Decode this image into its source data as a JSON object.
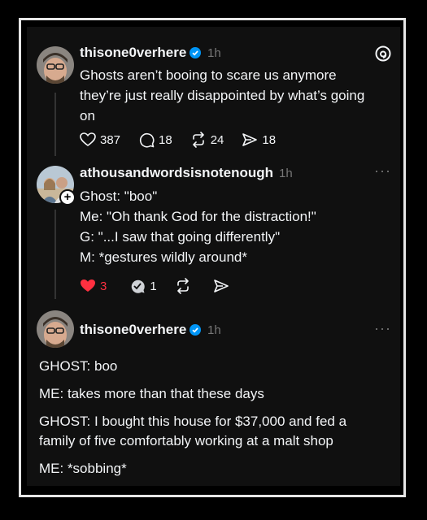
{
  "post1": {
    "username": "thisone0verhere",
    "time": "1h",
    "lines": [
      "Ghosts aren’t booing to scare us anymore",
      "they’re just really disappointed by what’s going",
      "on"
    ],
    "likes": "387",
    "replies": "18",
    "reposts": "24",
    "shares": "18"
  },
  "post2": {
    "username": "athousandwordsisnotenough",
    "time": "1h",
    "lines": [
      "Ghost: \"boo\"",
      "Me: \"Oh thank God for the distraction!\"",
      "G: \"...I saw that going differently\"",
      "M: *gestures wildly around*"
    ],
    "likes": "3",
    "replies": "1",
    "more": "···"
  },
  "post3": {
    "username": "thisone0verhere",
    "time": "1h",
    "more": "···",
    "paragraphs": [
      [
        "GHOST: boo"
      ],
      [
        "ME: takes more than that these days"
      ],
      [
        "GHOST: I bought this house for $37,000 and fed a",
        "family of five comfortably working at a malt shop"
      ],
      [
        "ME: *sobbing*"
      ]
    ]
  },
  "colors": {
    "accent_verified": "#0095f6",
    "like_red": "#ff3040",
    "muted": "#777777"
  },
  "icons": {
    "threads": "threads-logo-icon"
  }
}
